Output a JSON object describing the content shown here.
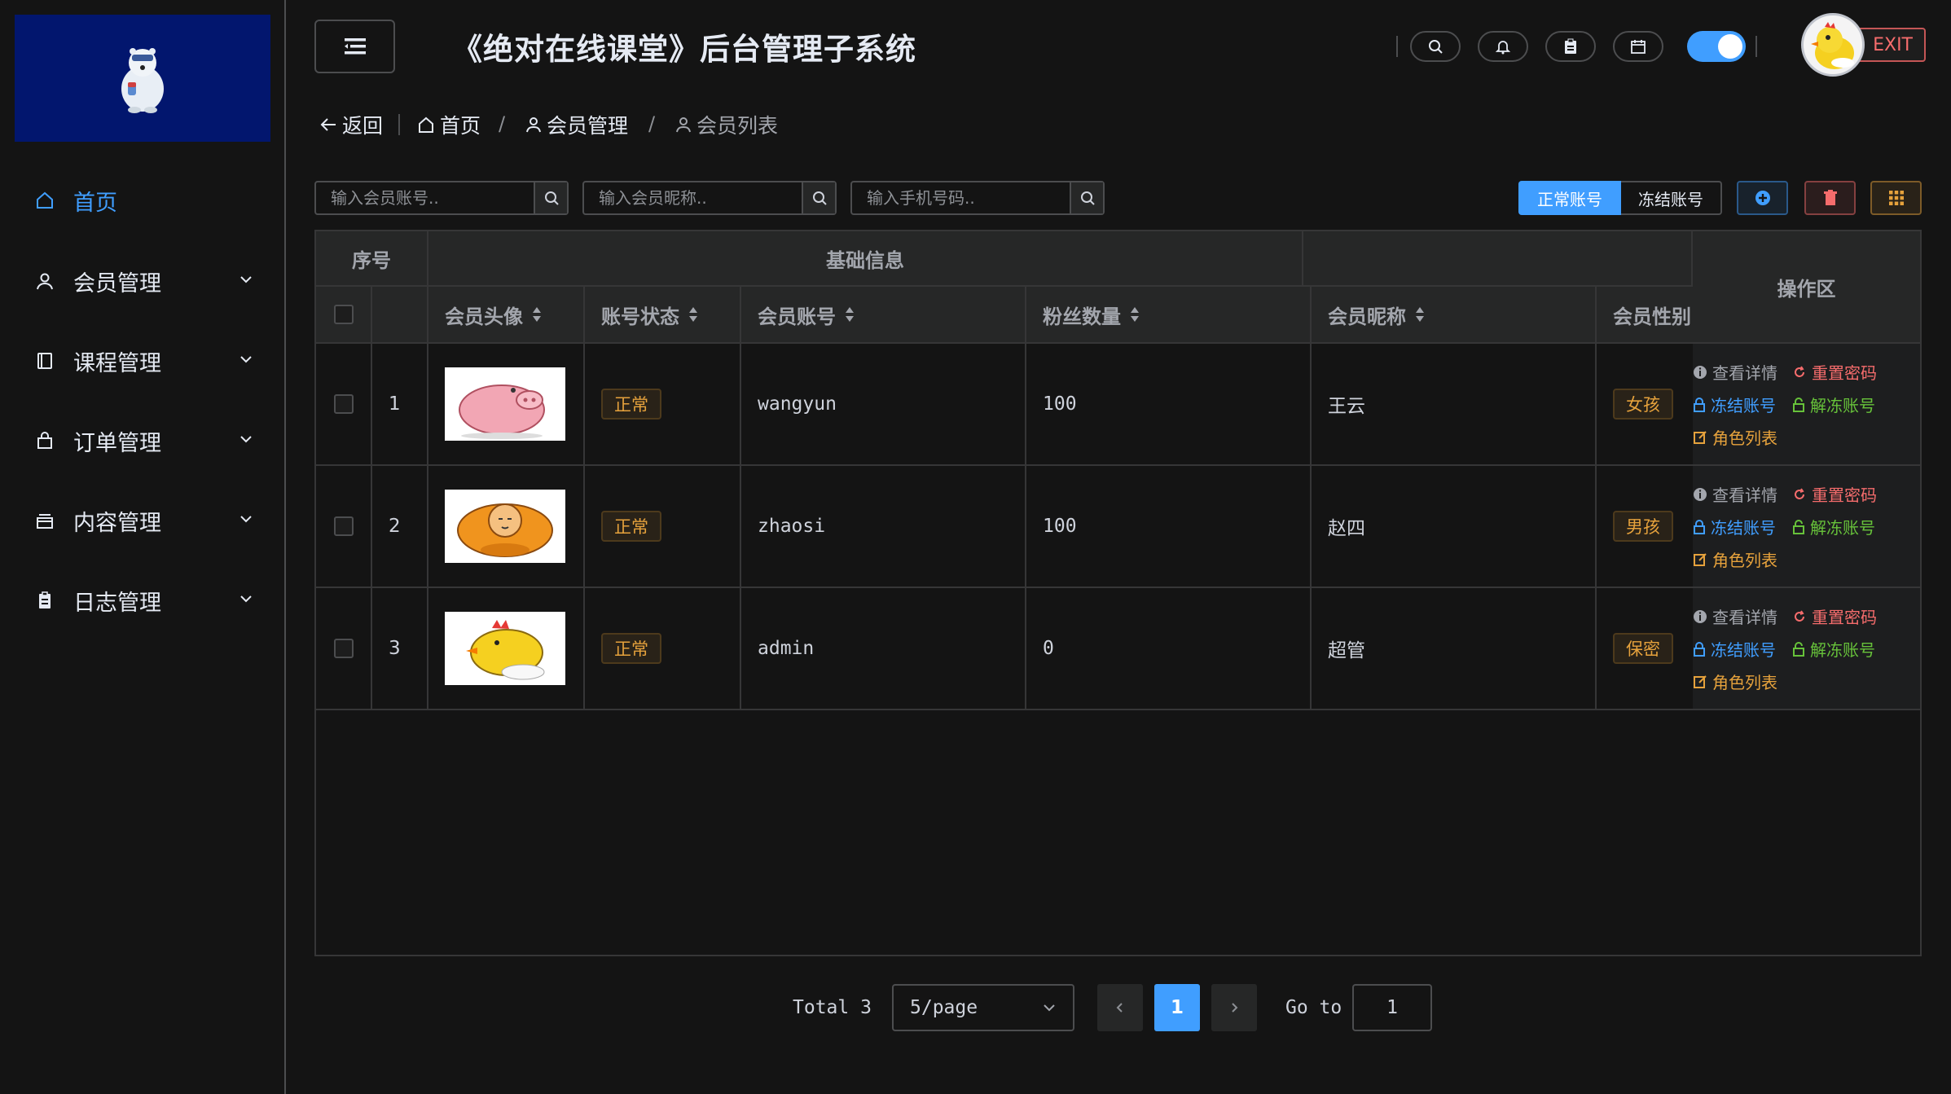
{
  "app": {
    "title": "《绝对在线课堂》后台管理子系统",
    "exit_label": "EXIT"
  },
  "sidebar": {
    "items": [
      {
        "label": "首页",
        "icon": "home-icon",
        "active": true
      },
      {
        "label": "会员管理",
        "icon": "user-icon"
      },
      {
        "label": "课程管理",
        "icon": "book-icon"
      },
      {
        "label": "订单管理",
        "icon": "bag-icon"
      },
      {
        "label": "内容管理",
        "icon": "box-icon"
      },
      {
        "label": "日志管理",
        "icon": "clipboard-icon"
      }
    ]
  },
  "breadcrumb": {
    "back": "返回",
    "home": "首页",
    "level1": "会员管理",
    "level2": "会员列表"
  },
  "search": {
    "account_placeholder": "输入会员账号..",
    "nickname_placeholder": "输入会员昵称..",
    "phone_placeholder": "输入手机号码.."
  },
  "toolbar": {
    "normal_label": "正常账号",
    "frozen_label": "冻结账号"
  },
  "table": {
    "group_headers": {
      "index": "序号",
      "basic": "基础信息",
      "ops": "操作区"
    },
    "columns": {
      "avatar": "会员头像",
      "status": "账号状态",
      "account": "会员账号",
      "fans": "粉丝数量",
      "nickname": "会员昵称",
      "gender": "会员性别"
    },
    "rows": [
      {
        "index": "1",
        "status": "正常",
        "account": "wangyun",
        "fans": "100",
        "nickname": "王云",
        "gender": "女孩",
        "avatar": "pig"
      },
      {
        "index": "2",
        "status": "正常",
        "account": "zhaosi",
        "fans": "100",
        "nickname": "赵四",
        "gender": "男孩",
        "avatar": "monk"
      },
      {
        "index": "3",
        "status": "正常",
        "account": "admin",
        "fans": "0",
        "nickname": "超管",
        "gender": "保密",
        "avatar": "chick"
      }
    ],
    "actions": {
      "detail": "查看详情",
      "reset": "重置密码",
      "freeze": "冻结账号",
      "unfreeze": "解冻账号",
      "roles": "角色列表"
    }
  },
  "pagination": {
    "total_label": "Total 3",
    "page_size": "5/page",
    "current": "1",
    "goto_label": "Go to",
    "goto_value": "1"
  },
  "colors": {
    "accent": "#409eff",
    "danger": "#f56c6c",
    "success": "#67c23a",
    "warning": "#e6a23c",
    "logo_bg": "#02166e"
  }
}
